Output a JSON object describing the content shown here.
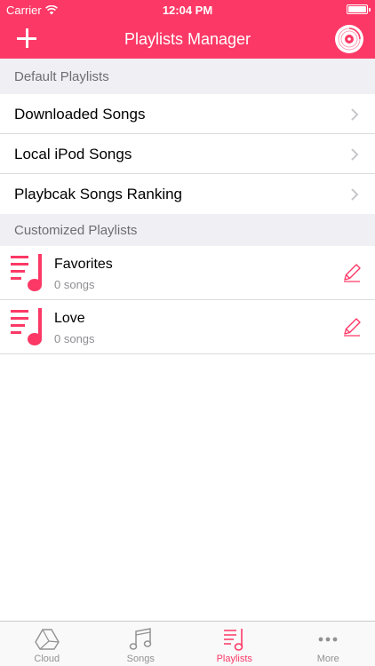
{
  "status_bar": {
    "carrier": "Carrier",
    "time": "12:04 PM"
  },
  "nav": {
    "title": "Playlists Manager"
  },
  "default_section": {
    "header": "Default Playlists",
    "items": [
      {
        "label": "Downloaded Songs"
      },
      {
        "label": "Local iPod Songs"
      },
      {
        "label": "Playbcak Songs Ranking"
      }
    ]
  },
  "custom_section": {
    "header": "Customized Playlists",
    "items": [
      {
        "name": "Favorites",
        "count": "0 songs"
      },
      {
        "name": "Love",
        "count": "0 songs"
      }
    ]
  },
  "tabs": [
    {
      "label": "Cloud",
      "icon": "cloud-drive-icon"
    },
    {
      "label": "Songs",
      "icon": "music-note-icon"
    },
    {
      "label": "Playlists",
      "icon": "playlist-icon",
      "active": true
    },
    {
      "label": "More",
      "icon": "more-dots-icon"
    }
  ],
  "colors": {
    "accent": "#fc3966",
    "section_bg": "#efeff4",
    "inactive_tab": "#929292"
  }
}
